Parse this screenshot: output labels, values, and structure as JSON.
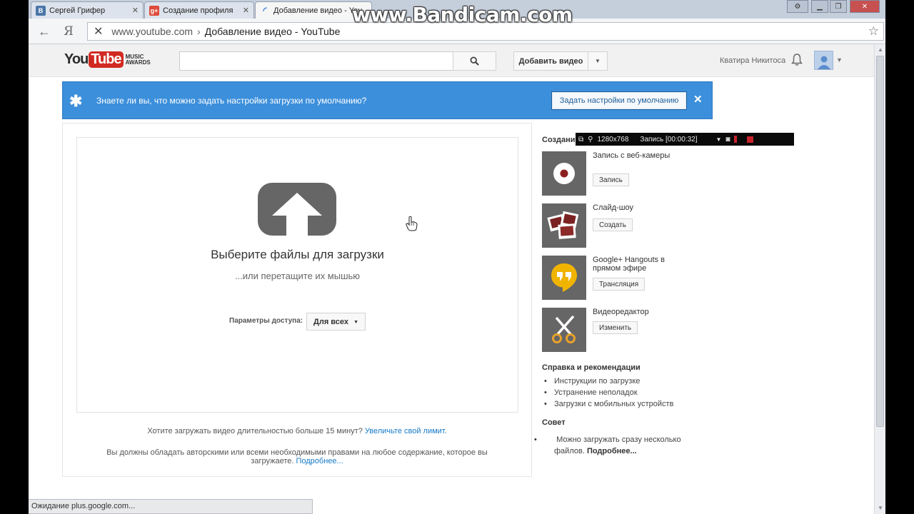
{
  "browser": {
    "tabs": [
      {
        "label": "Сергей Грифер",
        "favicon": "В",
        "favicon_color": "#4a76a8"
      },
      {
        "label": "Создание профиля",
        "favicon": "g+",
        "favicon_color": "#dd4b39"
      },
      {
        "label": "Добавление видео - You",
        "favicon": "",
        "favicon_color": ""
      }
    ],
    "address": {
      "url": "www.youtube.com",
      "separator": "›",
      "title": "Добавление видео - YouTube"
    },
    "status_text": "Ожидание plus.google.com..."
  },
  "watermark": "www.Bandicam.com",
  "recorder": {
    "resolution": "1280x768",
    "record_label": "Запись [00:00:32]"
  },
  "header": {
    "logo_you": "You",
    "logo_tube": "Tube",
    "logo_awards": "MUSIC AWARDS",
    "upload_label": "Добавить видео",
    "username": "Кватира Никитоса"
  },
  "banner": {
    "message": "Знаете ли вы, что можно задать настройки загрузки по умолчанию?",
    "button": "Задать настройки по умолчанию",
    "close": "✕",
    "accent": "#3c8fdb"
  },
  "upload": {
    "title": "Выберите файлы для загрузки",
    "subtitle": "...или перетащите их мышью",
    "privacy_label": "Параметры доступа:",
    "privacy_value": "Для всех",
    "hint1_text": "Хотите загружать видео длительностью больше 15 минут?",
    "hint1_link": "Увеличьте свой лимит.",
    "hint2_text": "Вы должны обладать авторскими или всеми необходимыми правами на любое содержание, которое вы загружаете.",
    "hint2_link": "Подробнее..."
  },
  "sidebar": {
    "title": "Создание",
    "tools": [
      {
        "label": "Запись с веб-камеры",
        "button": "Запись",
        "icon": "webcam-icon"
      },
      {
        "label": "Слайд-шоу",
        "button": "Создать",
        "icon": "slideshow-icon"
      },
      {
        "label": "Google+ Hangouts в прямом эфире",
        "button": "Трансляция",
        "icon": "hangouts-icon"
      },
      {
        "label": "Видеоредактор",
        "button": "Изменить",
        "icon": "scissors-icon"
      }
    ],
    "help_title": "Справка и рекомендации",
    "help_links": [
      "Инструкции по загрузке",
      "Устранение неполадок",
      "Загрузки с мобильных устройств"
    ],
    "tip_title": "Совет",
    "tip_text": "Можно загружать сразу несколько файлов.",
    "tip_link": "Подробнее..."
  }
}
